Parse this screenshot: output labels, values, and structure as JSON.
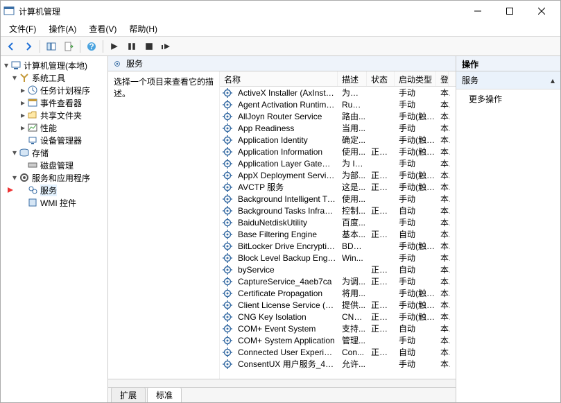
{
  "window": {
    "title": "计算机管理"
  },
  "menu": {
    "file": "文件(F)",
    "action": "操作(A)",
    "view": "查看(V)",
    "help": "帮助(H)"
  },
  "tree": {
    "root": "计算机管理(本地)",
    "systools": "系统工具",
    "taskscheduler": "任务计划程序",
    "eventviewer": "事件查看器",
    "sharedfolders": "共享文件夹",
    "performance": "性能",
    "devicemgr": "设备管理器",
    "storage": "存储",
    "diskmgmt": "磁盘管理",
    "servicesapps": "服务和应用程序",
    "services": "服务",
    "wmi": "WMI 控件"
  },
  "mid": {
    "header": "服务",
    "detail_prompt": "选择一个项目来查看它的描述。",
    "columns": {
      "name": "名称",
      "desc": "描述",
      "status": "状态",
      "start": "启动类型",
      "acct": "登"
    },
    "rows": [
      {
        "name": "ActiveX Installer (AxInstSV)",
        "desc": "为从 ...",
        "status": "",
        "start": "手动",
        "acct": "本"
      },
      {
        "name": "Agent Activation Runtime_...",
        "desc": "Runt...",
        "status": "",
        "start": "手动",
        "acct": "本"
      },
      {
        "name": "AllJoyn Router Service",
        "desc": "路由...",
        "status": "",
        "start": "手动(触发...",
        "acct": "本"
      },
      {
        "name": "App Readiness",
        "desc": "当用...",
        "status": "",
        "start": "手动",
        "acct": "本"
      },
      {
        "name": "Application Identity",
        "desc": "确定...",
        "status": "",
        "start": "手动(触发...",
        "acct": "本"
      },
      {
        "name": "Application Information",
        "desc": "使用...",
        "status": "正在...",
        "start": "手动(触发...",
        "acct": "本"
      },
      {
        "name": "Application Layer Gateway ...",
        "desc": "为 In...",
        "status": "",
        "start": "手动",
        "acct": "本"
      },
      {
        "name": "AppX Deployment Service ...",
        "desc": "为部...",
        "status": "正在...",
        "start": "手动(触发...",
        "acct": "本"
      },
      {
        "name": "AVCTP 服务",
        "desc": "这是...",
        "status": "正在...",
        "start": "手动(触发...",
        "acct": "本"
      },
      {
        "name": "Background Intelligent Tra...",
        "desc": "使用...",
        "status": "",
        "start": "手动",
        "acct": "本"
      },
      {
        "name": "Background Tasks Infrastru...",
        "desc": "控制...",
        "status": "正在...",
        "start": "自动",
        "acct": "本"
      },
      {
        "name": "BaiduNetdiskUtility",
        "desc": "百度...",
        "status": "",
        "start": "手动",
        "acct": "本"
      },
      {
        "name": "Base Filtering Engine",
        "desc": "基本...",
        "status": "正在...",
        "start": "自动",
        "acct": "本"
      },
      {
        "name": "BitLocker Drive Encryption ...",
        "desc": "BDE...",
        "status": "",
        "start": "手动(触发...",
        "acct": "本"
      },
      {
        "name": "Block Level Backup Engine ...",
        "desc": "Win...",
        "status": "",
        "start": "手动",
        "acct": "本"
      },
      {
        "name": "byService",
        "desc": "",
        "status": "正在...",
        "start": "自动",
        "acct": "本"
      },
      {
        "name": "CaptureService_4aeb7ca",
        "desc": "为调...",
        "status": "正在...",
        "start": "手动",
        "acct": "本"
      },
      {
        "name": "Certificate Propagation",
        "desc": "将用...",
        "status": "",
        "start": "手动(触发...",
        "acct": "本"
      },
      {
        "name": "Client License Service (Clip...",
        "desc": "提供...",
        "status": "正在...",
        "start": "手动(触发...",
        "acct": "本"
      },
      {
        "name": "CNG Key Isolation",
        "desc": "CNG...",
        "status": "正在...",
        "start": "手动(触发...",
        "acct": "本"
      },
      {
        "name": "COM+ Event System",
        "desc": "支持...",
        "status": "正在...",
        "start": "自动",
        "acct": "本"
      },
      {
        "name": "COM+ System Application",
        "desc": "管理...",
        "status": "",
        "start": "手动",
        "acct": "本"
      },
      {
        "name": "Connected User Experienc...",
        "desc": "Con...",
        "status": "正在...",
        "start": "自动",
        "acct": "本"
      },
      {
        "name": "ConsentUX 用户服务_4aeb...",
        "desc": "允许...",
        "status": "",
        "start": "手动",
        "acct": "本"
      }
    ]
  },
  "tabs": {
    "extended": "扩展",
    "standard": "标准"
  },
  "actions": {
    "header": "操作",
    "group_title": "服务",
    "more": "更多操作"
  }
}
